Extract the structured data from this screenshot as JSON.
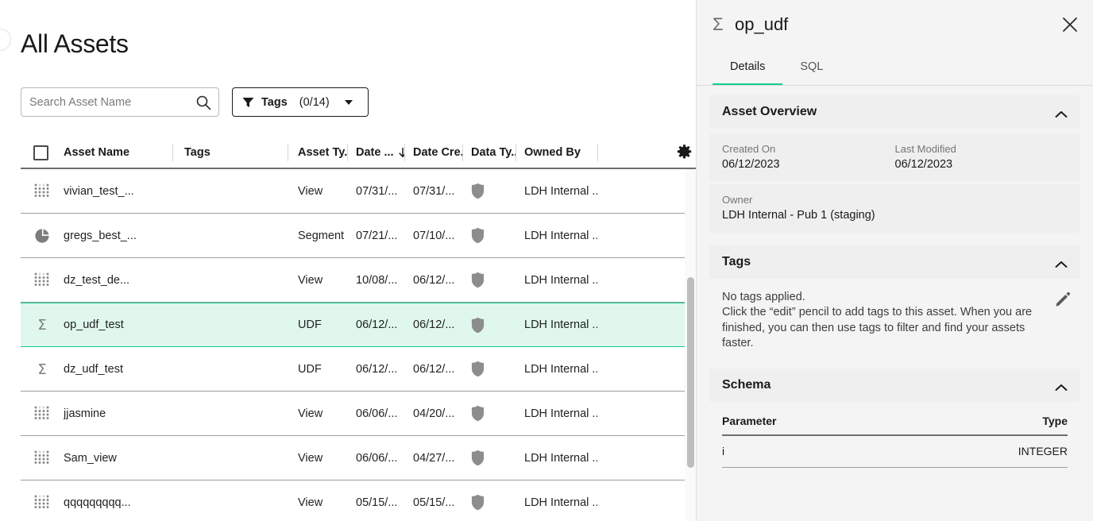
{
  "page": {
    "title": "All Assets"
  },
  "toolbar": {
    "search_placeholder": "Search Asset Name",
    "search_value": "",
    "tags_label": "Tags",
    "tags_count": "(0/14)"
  },
  "table": {
    "columns": [
      {
        "key": "check",
        "label": ""
      },
      {
        "key": "name",
        "label": "Asset Name"
      },
      {
        "key": "tags",
        "label": "Tags"
      },
      {
        "key": "type",
        "label": "Asset Ty..."
      },
      {
        "key": "dmod",
        "label": "Date ..."
      },
      {
        "key": "dcre",
        "label": "Date Cre..."
      },
      {
        "key": "dtype",
        "label": "Data Ty..."
      },
      {
        "key": "owner",
        "label": "Owned By"
      }
    ],
    "sorted_column": "Date ...",
    "sort_direction": "desc",
    "rows": [
      {
        "icon": "dot-grid-icon",
        "name": "vivian_test_...",
        "tags": "",
        "type": "View",
        "date_modified": "07/31/...",
        "date_created": "07/31/...",
        "data_type": "shield-icon",
        "owner": "LDH Internal ...",
        "selected": false
      },
      {
        "icon": "pie-chart-icon",
        "name": "gregs_best_...",
        "tags": "",
        "type": "Segment",
        "date_modified": "07/21/...",
        "date_created": "07/10/...",
        "data_type": "shield-icon",
        "owner": "LDH Internal ...",
        "selected": false
      },
      {
        "icon": "dot-grid-icon",
        "name": "dz_test_de...",
        "tags": "",
        "type": "View",
        "date_modified": "10/08/...",
        "date_created": "06/12/...",
        "data_type": "shield-icon",
        "owner": "LDH Internal ...",
        "selected": false
      },
      {
        "icon": "sigma-icon",
        "name": "op_udf_test",
        "tags": "",
        "type": "UDF",
        "date_modified": "06/12/...",
        "date_created": "06/12/...",
        "data_type": "shield-icon",
        "owner": "LDH Internal ...",
        "selected": true
      },
      {
        "icon": "sigma-icon",
        "name": "dz_udf_test",
        "tags": "",
        "type": "UDF",
        "date_modified": "06/12/...",
        "date_created": "06/12/...",
        "data_type": "shield-icon",
        "owner": "LDH Internal ...",
        "selected": false
      },
      {
        "icon": "dot-grid-icon",
        "name": "jjasmine",
        "tags": "",
        "type": "View",
        "date_modified": "06/06/...",
        "date_created": "04/20/...",
        "data_type": "shield-icon",
        "owner": "LDH Internal ...",
        "selected": false
      },
      {
        "icon": "dot-grid-icon",
        "name": "Sam_view",
        "tags": "",
        "type": "View",
        "date_modified": "06/06/...",
        "date_created": "04/27/...",
        "data_type": "shield-icon",
        "owner": "LDH Internal ...",
        "selected": false
      },
      {
        "icon": "dot-grid-icon",
        "name": "qqqqqqqqq...",
        "tags": "",
        "type": "View",
        "date_modified": "05/15/...",
        "date_created": "05/15/...",
        "data_type": "shield-icon",
        "owner": "LDH Internal ...",
        "selected": false
      }
    ]
  },
  "panel": {
    "title": "op_udf",
    "icon": "sigma-icon",
    "close_icon": "close-icon",
    "tabs": [
      {
        "label": "Details",
        "active": true
      },
      {
        "label": "SQL",
        "active": false
      }
    ],
    "asset_overview": {
      "section_title": "Asset Overview",
      "created_on_label": "Created On",
      "created_on_value": "06/12/2023",
      "last_modified_label": "Last Modified",
      "last_modified_value": "06/12/2023",
      "owner_label": "Owner",
      "owner_value": "LDH Internal - Pub 1 (staging)"
    },
    "tags": {
      "section_title": "Tags",
      "empty_line1": "No tags applied.",
      "empty_line2": "Click the “edit” pencil to add tags to this asset. When you are finished, you can then use tags to filter and find your assets faster."
    },
    "schema": {
      "section_title": "Schema",
      "col_parameter": "Parameter",
      "col_type": "Type",
      "rows": [
        {
          "parameter": "i",
          "type": "INTEGER"
        }
      ]
    }
  },
  "colors": {
    "accent_green": "#0fce93",
    "selected_row_bg": "#dff7ec",
    "panel_bg": "#f4f4f4",
    "section_header_bg": "#efefef",
    "icon_gray": "#8a8a8a"
  }
}
